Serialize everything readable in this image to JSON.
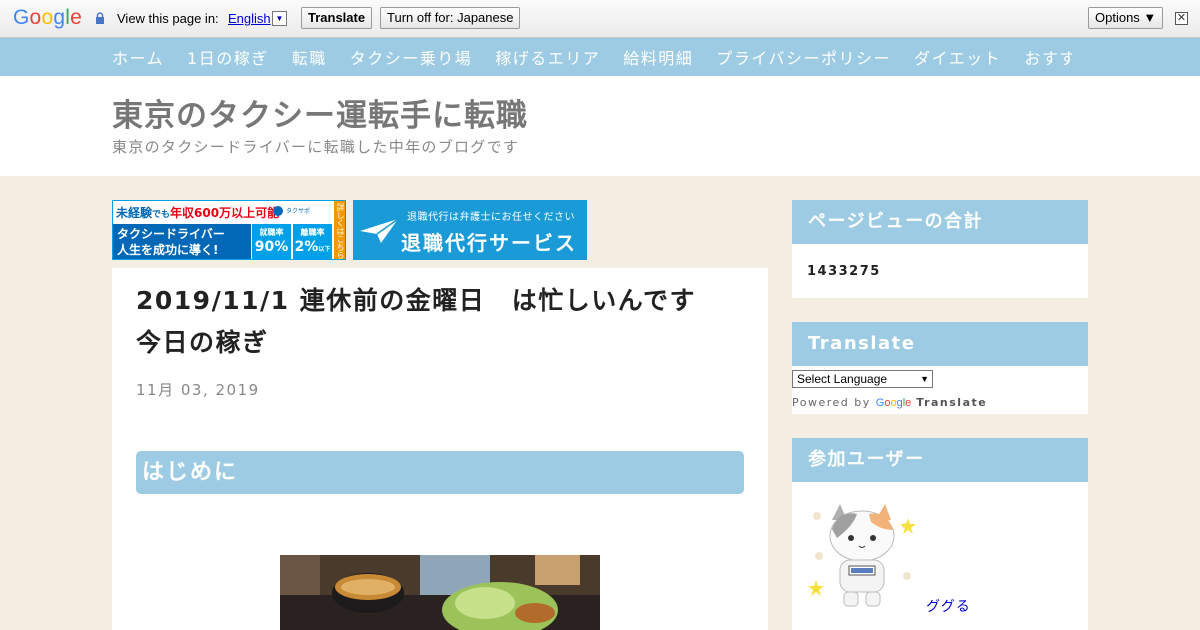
{
  "translate_bar": {
    "logo": "Google",
    "view_text": "View this page in:",
    "language": "English",
    "language_arrow": "▼",
    "translate_button": "Translate",
    "turn_off_button": "Turn off for: Japanese",
    "options_button": "Options ▼",
    "close_glyph": "✕"
  },
  "nav": {
    "items": [
      "ホーム",
      "1日の稼ぎ",
      "転職",
      "タクシー乗り場",
      "稼げるエリア",
      "給料明細",
      "プライバシーポリシー",
      "ダイエット",
      "おすす"
    ]
  },
  "header": {
    "title": "東京のタクシー運転手に転職",
    "description": "東京のタクシードライバーに転職した中年のブログです"
  },
  "banner1": {
    "top_prefix": "未経験",
    "top_mid": "でも",
    "top_highlight": "年収600万以上可能",
    "logo_text": "タクサポ",
    "line1": "タクシードライバー",
    "line2": "人生を成功に導く!",
    "stat1_label": "就職率",
    "stat1_value": "90%",
    "stat2_label": "離職率",
    "stat2_value": "2%",
    "stat2_suffix": "以下",
    "side": "詳しくはこちら"
  },
  "banner2": {
    "small": "退職代行は弁護士にお任せください",
    "big": "退職代行サービス"
  },
  "post": {
    "title": "2019/11/1 連休前の金曜日　は忙しいんです　今日の稼ぎ",
    "date": "11月 03, 2019",
    "heading": "はじめに"
  },
  "sidebar": {
    "pageviews": {
      "title": "ページビューの合計",
      "count": "1433275"
    },
    "translate": {
      "title": "Translate",
      "select_label": "Select Language",
      "select_arrow": "▼",
      "powered_by": "Powered by",
      "google": "Google",
      "translate": "Translate"
    },
    "users": {
      "title": "参加ユーザー",
      "name": "ググる"
    }
  },
  "colors": {
    "accent": "#9ccbe3",
    "background": "#f4eee2",
    "link": "#0000cc"
  }
}
